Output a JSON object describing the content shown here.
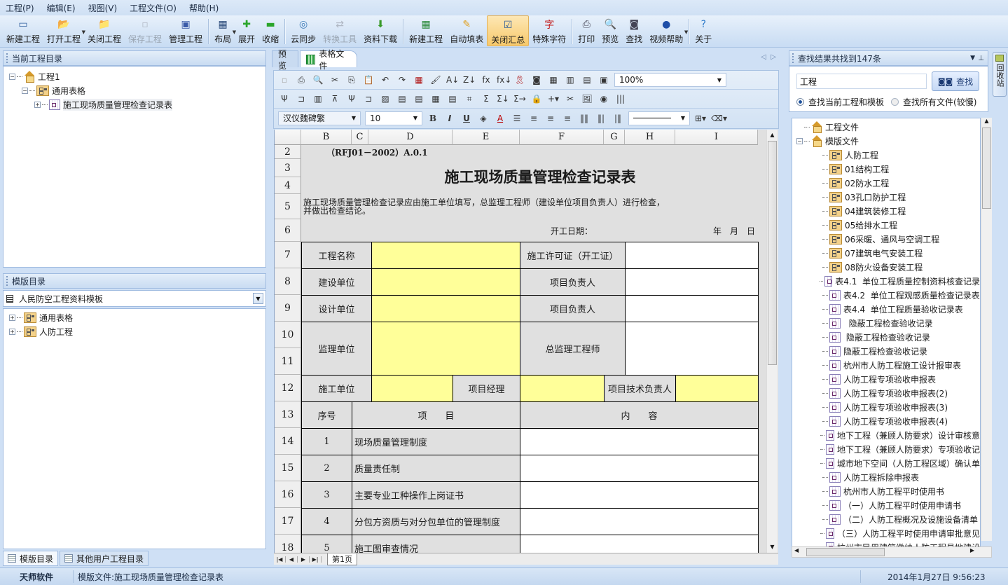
{
  "menu": [
    "工程(P)",
    "编辑(E)",
    "视图(V)",
    "工程文件(O)",
    "帮助(H)"
  ],
  "toolbar": [
    {
      "label": "新建工程",
      "icon": "new-project-icon"
    },
    {
      "label": "打开工程",
      "icon": "open-folder-icon",
      "dropdown": true
    },
    {
      "label": "关闭工程",
      "icon": "close-folder-icon"
    },
    {
      "label": "保存工程",
      "icon": "save-icon",
      "disabled": true
    },
    {
      "label": "管理工程",
      "icon": "manage-icon"
    },
    {
      "sep": true
    },
    {
      "label": "布局",
      "icon": "layout-icon",
      "dropdown": true
    },
    {
      "label": "展开",
      "icon": "plus-icon"
    },
    {
      "label": "收缩",
      "icon": "minus-icon"
    },
    {
      "sep": true
    },
    {
      "label": "云同步",
      "icon": "globe-icon"
    },
    {
      "label": "转换工具",
      "icon": "convert-icon",
      "disabled": true
    },
    {
      "label": "资料下载",
      "icon": "download-icon"
    },
    {
      "sep": true
    },
    {
      "label": "新建工程",
      "icon": "grid-icon"
    },
    {
      "label": "自动填表",
      "icon": "pencil-icon"
    },
    {
      "label": "关闭汇总",
      "icon": "checklist-icon",
      "active": true
    },
    {
      "label": "特殊字符",
      "icon": "char-icon"
    },
    {
      "sep": true
    },
    {
      "label": "打印",
      "icon": "printer-icon"
    },
    {
      "label": "预览",
      "icon": "preview-icon"
    },
    {
      "label": "查找",
      "icon": "binoculars-icon"
    },
    {
      "label": "视频帮助",
      "icon": "video-icon",
      "dropdown": true
    },
    {
      "sep": true
    },
    {
      "label": "关于",
      "icon": "help-icon"
    }
  ],
  "left": {
    "project_panel_title": "当前工程目录",
    "project_tree": [
      {
        "label": "工程1",
        "type": "home",
        "level": 0,
        "expander": "−"
      },
      {
        "label": "通用表格",
        "type": "folder",
        "level": 1,
        "expander": "−"
      },
      {
        "label": "施工现场质量管理检查记录表",
        "type": "sheet",
        "level": 2,
        "expander": "+"
      }
    ],
    "template_panel_title": "模版目录",
    "template_select": "人民防空工程资料模板",
    "template_tree": [
      {
        "label": "通用表格",
        "type": "folder",
        "expander": "+"
      },
      {
        "label": "人防工程",
        "type": "folder",
        "expander": "+"
      }
    ],
    "bottom_tabs": [
      "模版目录",
      "其他用户工程目录"
    ]
  },
  "doc": {
    "tabs": [
      "预览",
      "表格文件"
    ],
    "zoom": "100%",
    "font": "汉仪魏碑繁",
    "font_size": "10",
    "sheet_tab": "第1页",
    "columns": [
      "B",
      "C",
      "D",
      "E",
      "F",
      "G",
      "H",
      "I"
    ],
    "rows": [
      "2",
      "3",
      "4",
      "5",
      "6",
      "7",
      "8",
      "9",
      "10",
      "11",
      "12",
      "13",
      "14",
      "15",
      "16",
      "17",
      "18"
    ],
    "code": "（RFJ01－2002）A.0.1",
    "title": "施工现场质量管理检查记录表",
    "note": "施工现场质量管理检查记录应由施工单位填写，总监理工程师（建设单位项目负责人）进行检查，\n并做出检查结论。",
    "start_date_label": "开工日期：",
    "date_units": "年　月　日",
    "form": {
      "project_name": "工程名称",
      "permit": "施工许可证（开工证）",
      "builder": "建设单位",
      "designer": "设计单位",
      "pm1": "项目负责人",
      "pm2": "项目负责人",
      "supervisor": "监理单位",
      "chief_engineer": "总监理工程师",
      "contractor": "施工单位",
      "project_manager": "项目经理",
      "tech_lead": "项目技术负责人",
      "seq": "序号",
      "item": "项　　目",
      "content": "内　　容"
    },
    "items": [
      {
        "no": "1",
        "text": "现场质量管理制度"
      },
      {
        "no": "2",
        "text": "质量责任制"
      },
      {
        "no": "3",
        "text": "主要专业工种操作上岗证书"
      },
      {
        "no": "4",
        "text": "分包方资质与对分包单位的管理制度"
      },
      {
        "no": "5",
        "text": "施工图审查情况"
      }
    ]
  },
  "right": {
    "title": "查找结果共找到147条",
    "search_value": "工程",
    "search_button": "查找",
    "radio1": "查找当前工程和模板",
    "radio2": "查找所有文件(较慢)",
    "side_tab": "回收站",
    "results": [
      {
        "label": "工程文件",
        "type": "home",
        "level": 0
      },
      {
        "label": "模版文件",
        "type": "home",
        "level": 0,
        "expander": "−"
      },
      {
        "label": "人防工程",
        "type": "folder",
        "level": 1
      },
      {
        "label": "01结构工程",
        "type": "folder",
        "level": 1
      },
      {
        "label": "02防水工程",
        "type": "folder",
        "level": 1
      },
      {
        "label": "03孔口防护工程",
        "type": "folder",
        "level": 1
      },
      {
        "label": "04建筑装修工程",
        "type": "folder",
        "level": 1
      },
      {
        "label": "05给排水工程",
        "type": "folder",
        "level": 1
      },
      {
        "label": "06采暖、通风与空调工程",
        "type": "folder",
        "level": 1
      },
      {
        "label": "07建筑电气安装工程",
        "type": "folder",
        "level": 1
      },
      {
        "label": "08防火设备安装工程",
        "type": "folder",
        "level": 1
      },
      {
        "label": "表4.1  单位工程质量控制资料核查记录",
        "type": "sheet",
        "level": 1
      },
      {
        "label": "表4.2  单位工程观感质量检查记录表",
        "type": "sheet",
        "level": 1
      },
      {
        "label": "表4.4  单位工程质量验收记录表",
        "type": "sheet",
        "level": 1
      },
      {
        "label": "  隐蔽工程检查验收记录",
        "type": "sheet",
        "level": 1
      },
      {
        "label": " 隐蔽工程检查验收记录",
        "type": "sheet",
        "level": 1
      },
      {
        "label": "隐蔽工程检查验收记录",
        "type": "sheet",
        "level": 1
      },
      {
        "label": "杭州市人防工程施工设计报审表",
        "type": "sheet",
        "level": 1
      },
      {
        "label": "人防工程专项验收申报表",
        "type": "sheet",
        "level": 1
      },
      {
        "label": "人防工程专项验收申报表(2)",
        "type": "sheet",
        "level": 1
      },
      {
        "label": "人防工程专项验收申报表(3)",
        "type": "sheet",
        "level": 1
      },
      {
        "label": "人防工程专项验收申报表(4)",
        "type": "sheet",
        "level": 1
      },
      {
        "label": "地下工程（兼顾人防要求）设计审核意",
        "type": "sheet",
        "level": 1
      },
      {
        "label": "地下工程（兼顾人防要求）专项验收记",
        "type": "sheet",
        "level": 1
      },
      {
        "label": "城市地下空间（人防工程区域）确认单",
        "type": "sheet",
        "level": 1
      },
      {
        "label": "人防工程拆除申报表",
        "type": "sheet",
        "level": 1
      },
      {
        "label": "杭州市人防工程平时使用书",
        "type": "sheet",
        "level": 1
      },
      {
        "label": "（一）人防工程平时使用申请书",
        "type": "sheet",
        "level": 1
      },
      {
        "label": "（二）人防工程概况及设施设备清单",
        "type": "sheet",
        "level": 1
      },
      {
        "label": "（三）人防工程平时使用申请审批意见",
        "type": "sheet",
        "level": 1
      },
      {
        "label": "杭州市民用建筑缴纳人防工程易地建设",
        "type": "sheet",
        "level": 1
      }
    ]
  },
  "status": {
    "company": "天师软件",
    "file": "模版文件:施工现场质量管理检查记录表",
    "datetime": "2014年1月27日  9:56:23"
  }
}
